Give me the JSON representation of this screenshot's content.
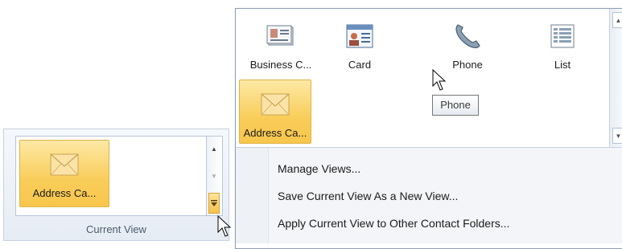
{
  "ribbon": {
    "selected_view_label": "Address Ca...",
    "group_label": "Current View",
    "scroll_up_icon": "triangle-up",
    "scroll_down_icon": "triangle-down",
    "more_icon": "gallery-more"
  },
  "gallery": {
    "views": [
      {
        "label": "Business C...",
        "icon": "business-card-icon",
        "selected": false
      },
      {
        "label": "Card",
        "icon": "card-icon",
        "selected": false
      },
      {
        "label": "Phone",
        "icon": "phone-icon",
        "selected": false
      },
      {
        "label": "List",
        "icon": "list-icon",
        "selected": false
      },
      {
        "label": "Address Ca...",
        "icon": "envelope-icon",
        "selected": true
      }
    ]
  },
  "menu": {
    "items": [
      {
        "label": "Manage Views...",
        "accelerator": "M"
      },
      {
        "label": "Save Current View As a New View...",
        "accelerator": "S"
      },
      {
        "label": "Apply Current View to Other Contact Folders...",
        "accelerator": "A"
      }
    ]
  },
  "tooltip": {
    "text": "Phone"
  },
  "colors": {
    "selected_tile": "#f9cd5a",
    "ribbon_bg": "#e6ecf4",
    "border": "#8e9fb5"
  }
}
